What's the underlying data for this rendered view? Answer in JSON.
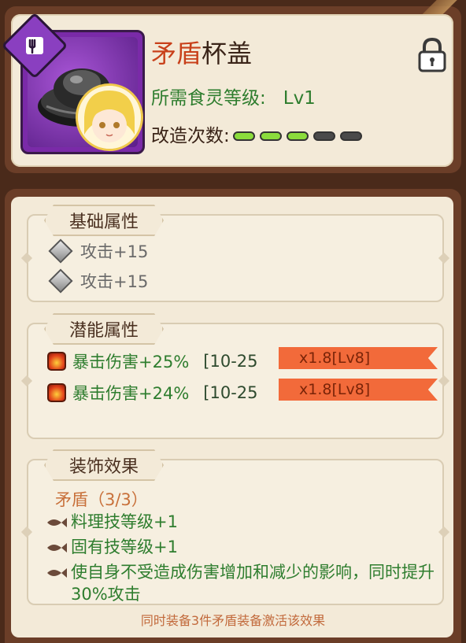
{
  "header": {
    "item_name_accent": "矛盾",
    "item_name_rest": "杯盖",
    "required_level_label": "所需食灵等级:",
    "required_level_value": "Lv1",
    "refine_label": "改造次数:",
    "refine_filled": 3,
    "refine_total": 5
  },
  "basic_section": {
    "title": "基础属性",
    "stats": [
      "攻击+15",
      "攻击+15"
    ]
  },
  "potential_section": {
    "title": "潜能属性",
    "stats": [
      {
        "text": "暴击伤害+25%",
        "range": "[10-25",
        "badge": "x1.8[Lv8]"
      },
      {
        "text": "暴击伤害+24%",
        "range": "[10-25",
        "badge": "x1.8[Lv8]"
      }
    ]
  },
  "set_section": {
    "title": "装饰效果",
    "set_name": "矛盾（3/3）",
    "effects": [
      "料理技等级+1",
      "固有技等级+1",
      "使自身不受造成伤害增加和减少的影响，同时提升30%攻击"
    ]
  },
  "footer_note": "同时装备3件矛盾装备激活该效果",
  "colors": {
    "green_text": "#2e7d2e",
    "accent_red": "#c8401a",
    "badge_orange": "#f26a3a",
    "pip_on": "#8bdc3c",
    "pip_off": "#4a4a4a"
  },
  "icons": [
    "equip-tag-icon",
    "lock-icon",
    "gem-icon",
    "fire-icon",
    "fish-bullet-icon"
  ]
}
